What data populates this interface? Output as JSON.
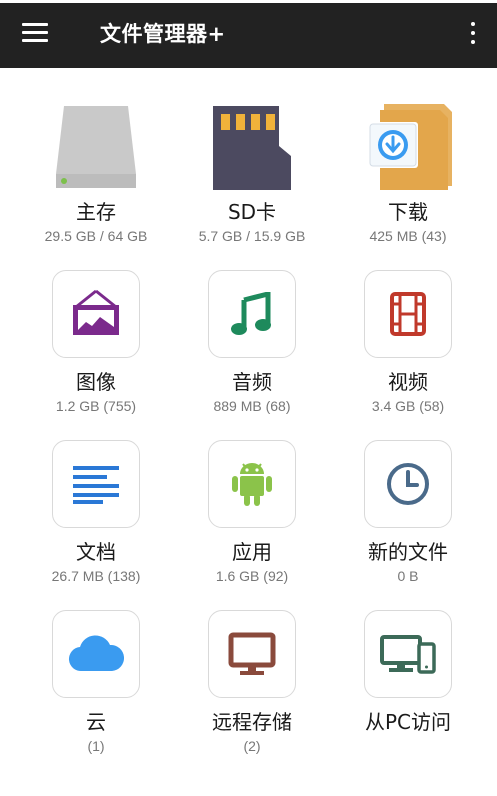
{
  "header": {
    "title": "文件管理器+"
  },
  "items": [
    {
      "label": "主存",
      "sub": "29.5 GB / 64 GB",
      "icon": "internal-storage-icon"
    },
    {
      "label": "SD卡",
      "sub": "5.7 GB / 15.9 GB",
      "icon": "sd-card-icon"
    },
    {
      "label": "下载",
      "sub": "425 MB (43)",
      "icon": "download-folder-icon"
    },
    {
      "label": "图像",
      "sub": "1.2 GB (755)",
      "icon": "image-icon"
    },
    {
      "label": "音频",
      "sub": "889 MB (68)",
      "icon": "music-note-icon"
    },
    {
      "label": "视频",
      "sub": "3.4 GB (58)",
      "icon": "film-icon"
    },
    {
      "label": "文档",
      "sub": "26.7 MB (138)",
      "icon": "document-icon"
    },
    {
      "label": "应用",
      "sub": "1.6 GB (92)",
      "icon": "android-icon"
    },
    {
      "label": "新的文件",
      "sub": "0 B",
      "icon": "clock-icon"
    },
    {
      "label": "云",
      "sub": "(1)",
      "icon": "cloud-icon"
    },
    {
      "label": "远程存储",
      "sub": "(2)",
      "icon": "monitor-icon"
    },
    {
      "label": "从PC访问",
      "sub": "",
      "icon": "pc-phone-icon"
    }
  ],
  "colors": {
    "appbar": "#222222",
    "image": "#7b2a8c",
    "audio": "#1e8a5c",
    "video": "#c0392b",
    "document": "#2a78d6",
    "android": "#8bc34a",
    "recent": "#4a6a8a",
    "cloud": "#3a9bf0",
    "remote": "#8a4a3c",
    "pc": "#3c6a58",
    "folder": "#e3a64b"
  }
}
